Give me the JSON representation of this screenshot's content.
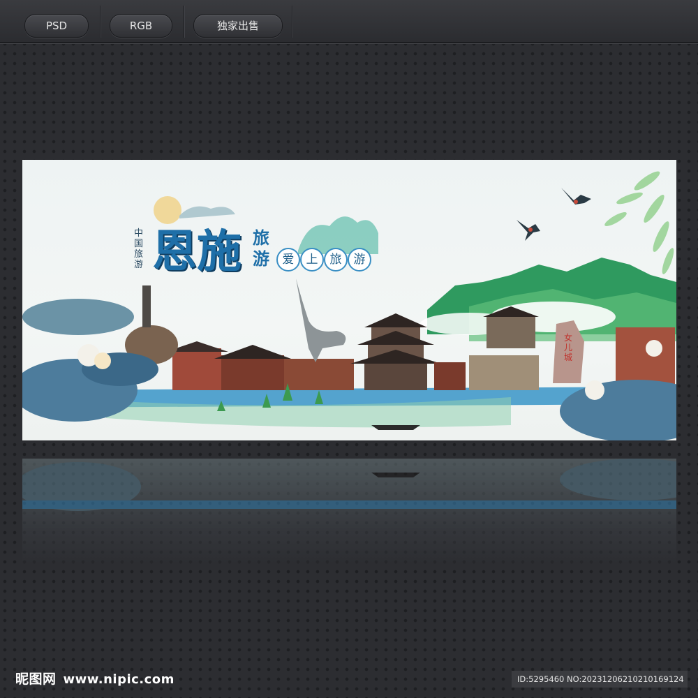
{
  "toolbar": {
    "tabs": [
      {
        "label": "PSD"
      },
      {
        "label": "RGB"
      },
      {
        "label": "独家出售"
      }
    ]
  },
  "banner": {
    "badge_text": "中国旅游",
    "title_main": "恩施",
    "title_side_top": "旅",
    "title_side_bottom": "游",
    "slogan_chars": [
      "爱",
      "上",
      "旅",
      "游"
    ],
    "rock_text": "女儿城",
    "colors": {
      "title_blue": "#1e6fa8",
      "mountain_green": "#2f9a5f",
      "water_blue": "#2d8fc4"
    }
  },
  "footer": {
    "brand": "昵图网",
    "site": "www.nipic.com",
    "id_text": "ID:5295460 NO:20231206210210169124"
  }
}
